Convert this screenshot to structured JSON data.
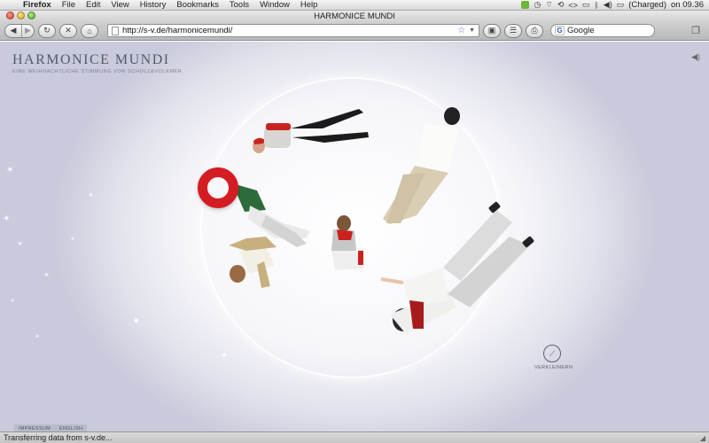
{
  "menubar": {
    "app": "Firefox",
    "items": [
      "File",
      "Edit",
      "View",
      "History",
      "Bookmarks",
      "Tools",
      "Window",
      "Help"
    ],
    "battery": "(Charged)",
    "clock": "on 09.36"
  },
  "window": {
    "title": "HARMONICE MUNDI"
  },
  "toolbar": {
    "url": "http://s-v.de/harmonicemundi/",
    "search_placeholder": "Google"
  },
  "site": {
    "title": "HARMONICE MUNDI",
    "subtitle": "EINE WEIHNACHTLICHE STIMMUNG VON SCHOLZ&VOLKMER",
    "zoom_label": "VERKLEINERN",
    "footer_links": [
      "IMPRESSUM",
      "ENGLISH"
    ]
  },
  "status": {
    "message": "Transferring data from s-v.de..."
  },
  "colors": {
    "ring": "#d41d23",
    "accent_text": "#555a6a"
  }
}
